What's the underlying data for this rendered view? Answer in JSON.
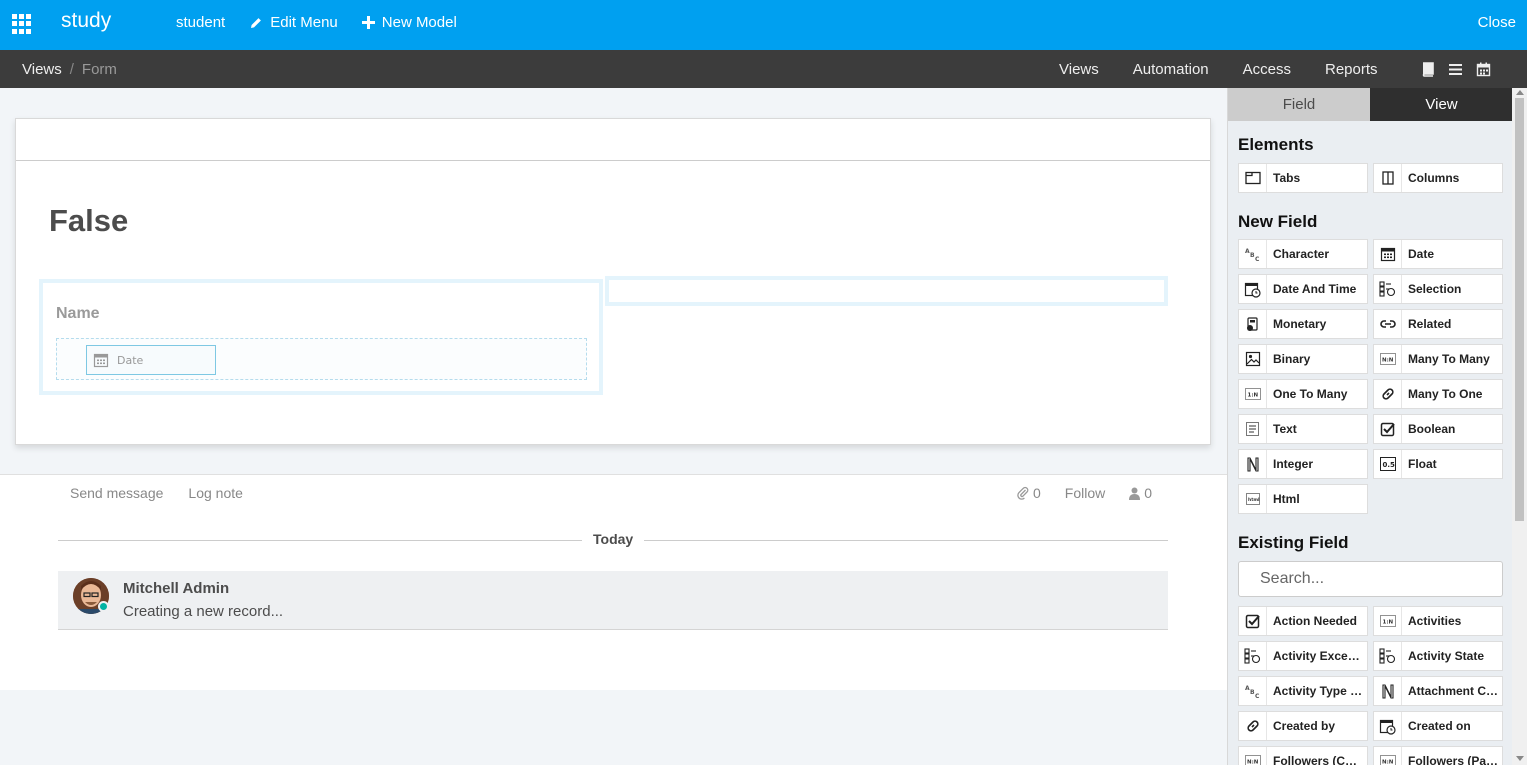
{
  "topbar": {
    "brand": "study",
    "nav": [
      {
        "label": "student"
      },
      {
        "label": "Edit Menu"
      },
      {
        "label": "New Model"
      }
    ],
    "close_label": "Close"
  },
  "subbar": {
    "breadcrumb": {
      "parent": "Views",
      "separator": "/",
      "current": "Form"
    },
    "nav": [
      "Views",
      "Automation",
      "Access",
      "Reports"
    ],
    "icons": [
      "book-icon",
      "list-icon",
      "calendar-icon"
    ]
  },
  "form": {
    "title": "False",
    "group_label": "Name",
    "date_field_label": "Date"
  },
  "chatter": {
    "send_message": "Send message",
    "log_note": "Log note",
    "attachments_count": "0",
    "follow": "Follow",
    "followers_count": "0",
    "today_label": "Today",
    "message": {
      "author": "Mitchell Admin",
      "body": "Creating a new record..."
    }
  },
  "sidebar": {
    "tabs": [
      "Field",
      "View"
    ],
    "elements_title": "Elements",
    "elements": [
      {
        "label": "Tabs",
        "icon": "tabs-icon"
      },
      {
        "label": "Columns",
        "icon": "columns-icon"
      }
    ],
    "new_field_title": "New Field",
    "new_fields": [
      {
        "label": "Character",
        "icon": "character-icon"
      },
      {
        "label": "Date",
        "icon": "date-icon"
      },
      {
        "label": "Date And Time",
        "icon": "datetime-icon"
      },
      {
        "label": "Selection",
        "icon": "selection-icon"
      },
      {
        "label": "Monetary",
        "icon": "monetary-icon"
      },
      {
        "label": "Related",
        "icon": "related-icon"
      },
      {
        "label": "Binary",
        "icon": "binary-icon"
      },
      {
        "label": "Many To Many",
        "icon": "many2many-icon"
      },
      {
        "label": "One To Many",
        "icon": "one2many-icon"
      },
      {
        "label": "Many To One",
        "icon": "many2one-icon"
      },
      {
        "label": "Text",
        "icon": "text-icon"
      },
      {
        "label": "Boolean",
        "icon": "boolean-icon"
      },
      {
        "label": "Integer",
        "icon": "integer-icon"
      },
      {
        "label": "Float",
        "icon": "float-icon"
      },
      {
        "label": "Html",
        "icon": "html-icon"
      }
    ],
    "existing_field_title": "Existing Field",
    "search_placeholder": "Search...",
    "existing_fields": [
      {
        "label": "Action Needed",
        "icon": "boolean-icon"
      },
      {
        "label": "Activities",
        "icon": "one2many-icon"
      },
      {
        "label": "Activity Except...",
        "icon": "selection-icon"
      },
      {
        "label": "Activity State",
        "icon": "selection-icon"
      },
      {
        "label": "Activity Type Ic...",
        "icon": "character-icon"
      },
      {
        "label": "Attachment Co...",
        "icon": "integer-icon"
      },
      {
        "label": "Created by",
        "icon": "many2one-icon"
      },
      {
        "label": "Created on",
        "icon": "datetime-icon"
      },
      {
        "label": "Followers (Cha...",
        "icon": "many2many-icon"
      },
      {
        "label": "Followers (Part...",
        "icon": "many2many-icon"
      }
    ]
  },
  "colors": {
    "topbar": "#00a0f0",
    "subbar": "#3c3c3c",
    "online": "#00b3a4"
  }
}
